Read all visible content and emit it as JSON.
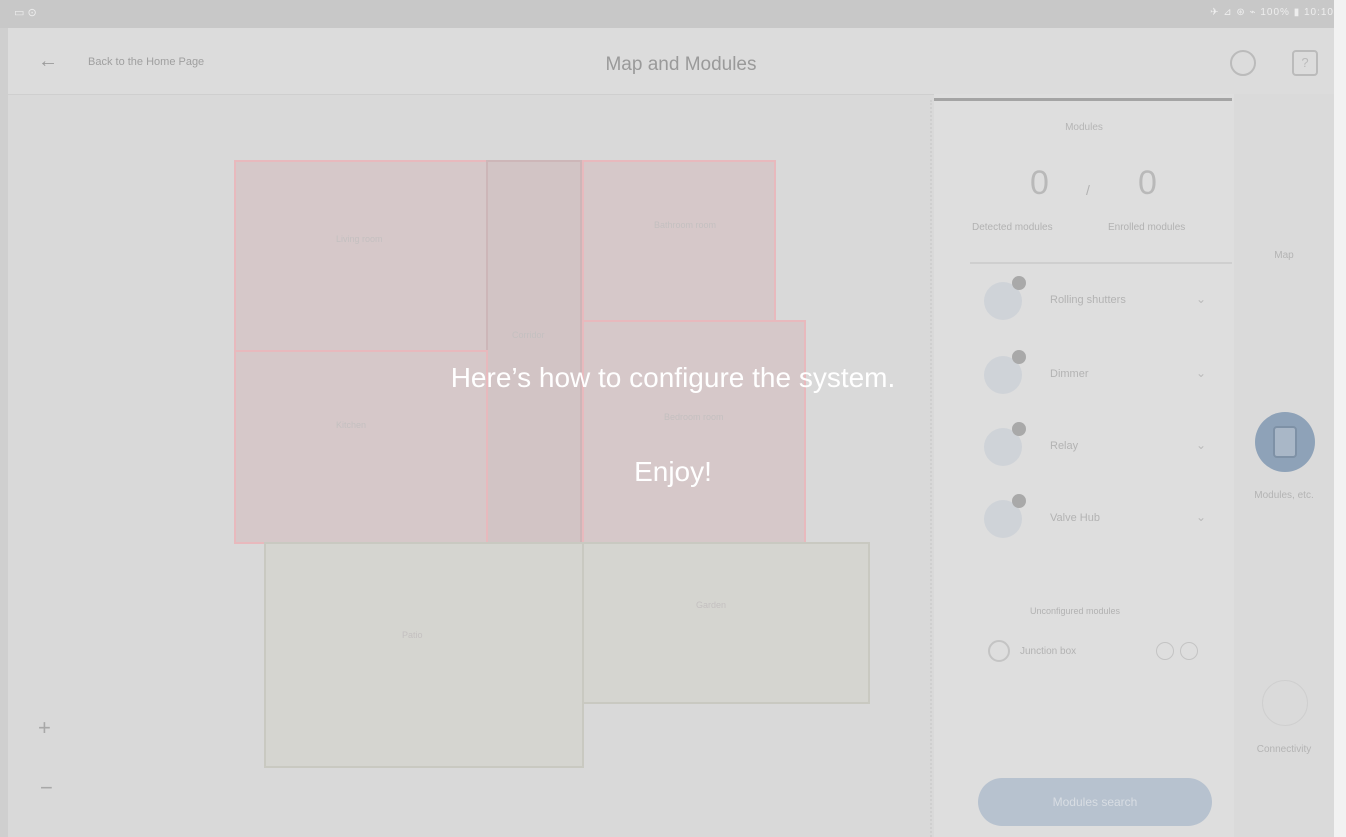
{
  "status_bar": {
    "left": "▭ ⊙",
    "right": "✈ ⊿ ⊛ ⌁ 100% ▮ 10:10"
  },
  "header": {
    "back_label": "Back to the Home Page",
    "title": "Map and Modules"
  },
  "map": {
    "rooms": [
      {
        "label": "Living\nroom"
      },
      {
        "label": "Corridor"
      },
      {
        "label": "Bathroom\nroom"
      },
      {
        "label": "Kitchen"
      },
      {
        "label": "Bedroom\nroom"
      },
      {
        "label": "Patio"
      },
      {
        "label": "Garden"
      }
    ],
    "zoom_in": "+",
    "zoom_out": "−"
  },
  "panel": {
    "modules_title": "Modules",
    "discovered_count": "0",
    "enrolled_count": "0",
    "separator": "/",
    "discovered_label": "Detected modules",
    "enrolled_label": "Enrolled modules",
    "modules": [
      {
        "name": "Rolling shutters",
        "icon": "shutter-icon"
      },
      {
        "name": "Dimmer",
        "icon": "dimmer-icon"
      },
      {
        "name": "Relay",
        "icon": "relay-icon"
      },
      {
        "name": "Valve Hub",
        "icon": "valve-icon"
      }
    ],
    "junction_header": "Unconfigured modules",
    "junction_label": "Junction box",
    "search_button": "Modules search"
  },
  "rail": {
    "map_label": "Map",
    "modules_label": "Modules, etc.",
    "connect_label": "Connectivity"
  },
  "overlay": {
    "line1": "Here’s how to configure the system.",
    "line2": "Enjoy!"
  },
  "colors": {
    "accent": "#8ea2b8",
    "room_border": "#e8b9bd"
  }
}
